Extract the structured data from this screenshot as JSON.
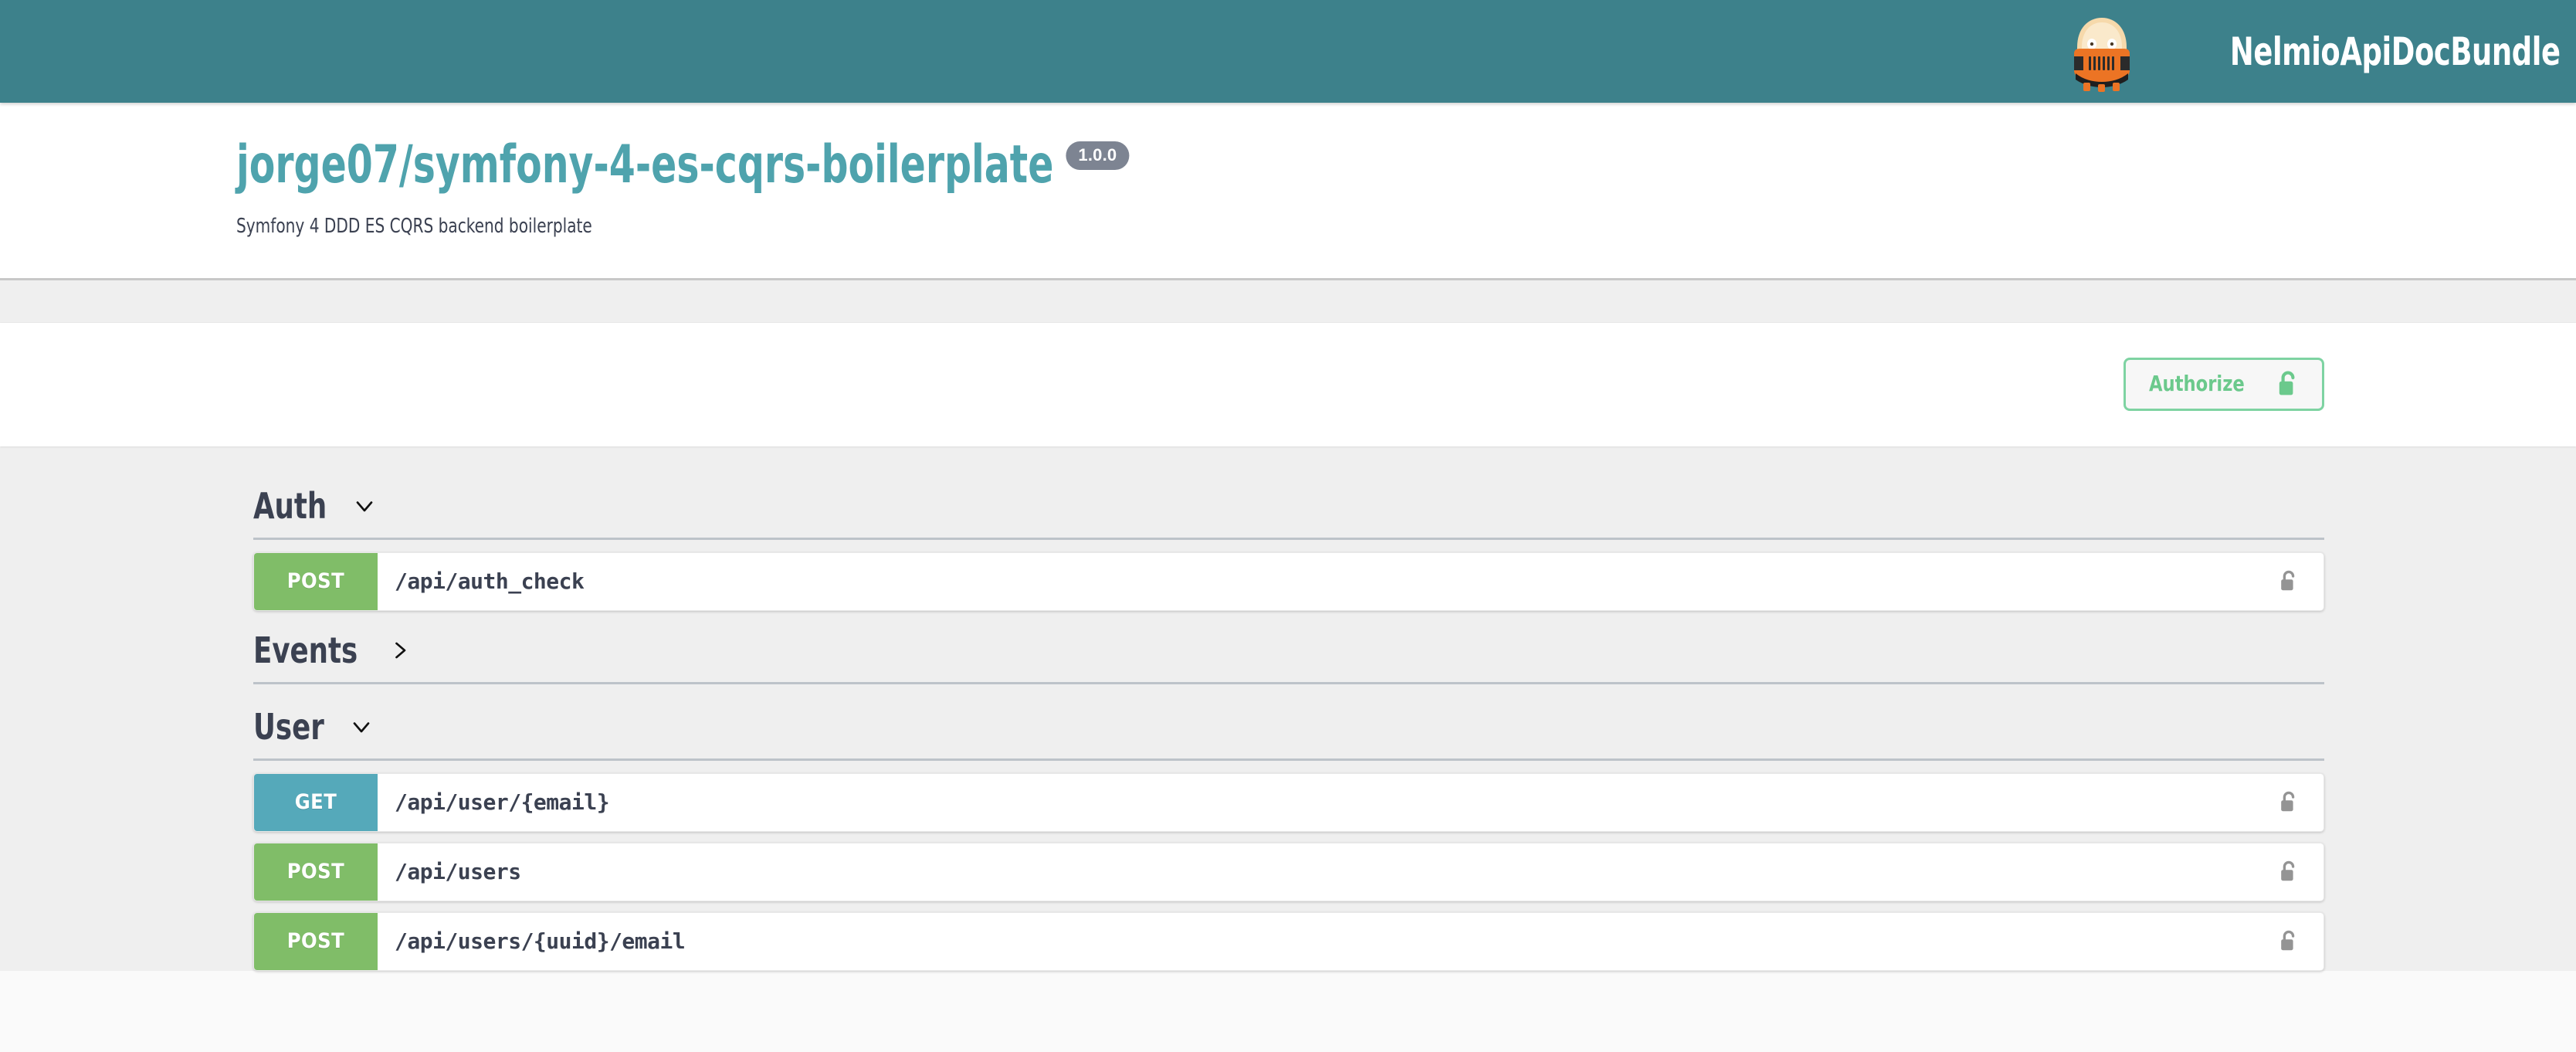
{
  "header": {
    "brand_name": "NelmioApiDocBundle",
    "logo_icon": "nelmio-robot-logo",
    "background_color": "#3d818b"
  },
  "info": {
    "title": "jorge07/symfony-4-es-cqrs-boilerplate",
    "version": "1.0.0",
    "description": "Symfony 4 DDD ES CQRS backend boilerplate",
    "title_color": "#4fa3ad",
    "version_badge_color": "#7d8492"
  },
  "auth": {
    "authorize_label": "Authorize",
    "authorize_icon": "unlock-icon",
    "accent_color": "#6bc98c"
  },
  "sections": [
    {
      "name": "Auth",
      "expanded": true,
      "toggle_icon": "chevron-down-icon",
      "operations": [
        {
          "method": "POST",
          "method_class": "post",
          "path": "/api/auth_check",
          "lock_icon": "unlock-icon",
          "method_color": "#80bd68"
        }
      ]
    },
    {
      "name": "Events",
      "expanded": false,
      "toggle_icon": "chevron-right-icon",
      "operations": []
    },
    {
      "name": "User",
      "expanded": true,
      "toggle_icon": "chevron-down-icon",
      "operations": [
        {
          "method": "GET",
          "method_class": "get",
          "path": "/api/user/{email}",
          "lock_icon": "unlock-icon",
          "method_color": "#55a9ba"
        },
        {
          "method": "POST",
          "method_class": "post",
          "path": "/api/users",
          "lock_icon": "unlock-icon",
          "method_color": "#80bd68"
        },
        {
          "method": "POST",
          "method_class": "post",
          "path": "/api/users/{uuid}/email",
          "lock_icon": "unlock-icon",
          "method_color": "#80bd68"
        }
      ]
    }
  ]
}
